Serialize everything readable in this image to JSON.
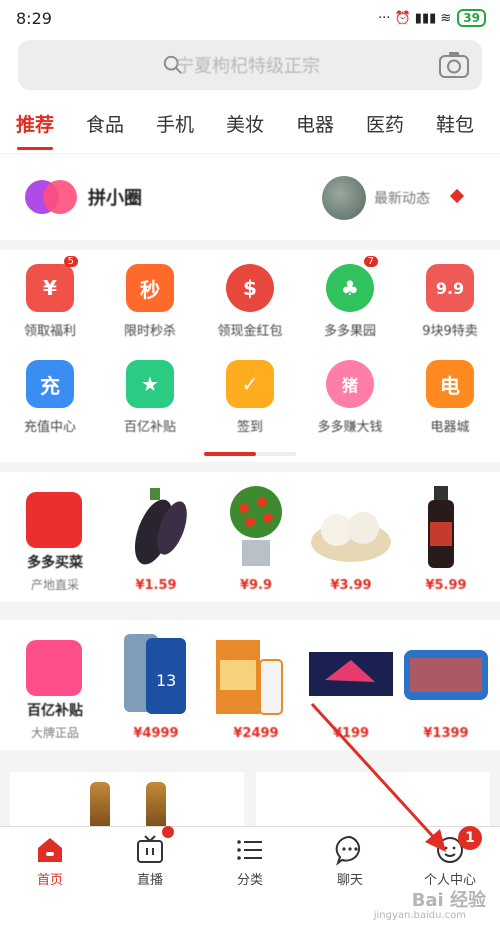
{
  "status_bar": {
    "time": "8:29",
    "icons": "··· ⏰ ▮▮▮ ≋",
    "battery": "39"
  },
  "search": {
    "placeholder": "宁夏枸杞特级正宗"
  },
  "tabs": [
    "推荐",
    "食品",
    "手机",
    "美妆",
    "电器",
    "医药",
    "鞋包"
  ],
  "brand_row": {
    "name": "拼小圈",
    "right_text": "最新动态"
  },
  "shortcuts": [
    {
      "label": "领取福利",
      "icon_text": "¥",
      "color": "#f0524a",
      "badge": "5"
    },
    {
      "label": "限时秒杀",
      "icon_text": "秒",
      "color": "#ff6a2a",
      "badge": ""
    },
    {
      "label": "领现金红包",
      "icon_text": "$",
      "color": "#e8473d",
      "badge": ""
    },
    {
      "label": "多多果园",
      "icon_text": "♣",
      "color": "#30c25d",
      "badge": "7"
    },
    {
      "label": "9块9特卖",
      "icon_text": "9.9",
      "color": "#f05a56",
      "badge": ""
    },
    {
      "label": "充值中心",
      "icon_text": "充",
      "color": "#3a8df2",
      "badge": ""
    },
    {
      "label": "百亿补贴",
      "icon_text": "★",
      "color": "#2ccb84",
      "badge": ""
    },
    {
      "label": "签到",
      "icon_text": "✓",
      "color": "#ffac1f",
      "badge": ""
    },
    {
      "label": "多多赚大钱",
      "icon_text": "猪",
      "color": "#ff7ea8",
      "badge": ""
    },
    {
      "label": "电器城",
      "icon_text": "电",
      "color": "#ff8a1f",
      "badge": ""
    }
  ],
  "deal_rows": [
    {
      "title": "多多买菜",
      "subtitle": "产地直采",
      "logo_color": "#e9302f",
      "prices": [
        "¥1.59",
        "¥9.9",
        "¥3.99",
        "¥5.99"
      ]
    },
    {
      "title": "百亿补贴",
      "subtitle": "大牌正品",
      "logo_color": "#ff4f8b",
      "prices": [
        "¥4999",
        "¥2499",
        "¥199",
        "¥1399"
      ]
    }
  ],
  "bottom_nav": [
    {
      "label": "首页",
      "icon": "home-icon",
      "active": true
    },
    {
      "label": "直播",
      "icon": "tv-icon",
      "active": false
    },
    {
      "label": "分类",
      "icon": "list-icon",
      "active": false
    },
    {
      "label": "聊天",
      "icon": "chat-icon",
      "active": false
    },
    {
      "label": "个人中心",
      "icon": "profile-icon",
      "active": false
    }
  ],
  "notification_count": "1",
  "watermark": {
    "text": "Bai 经验",
    "sub": "jingyan.baidu.com"
  },
  "colors": {
    "accent": "#e02e24"
  }
}
